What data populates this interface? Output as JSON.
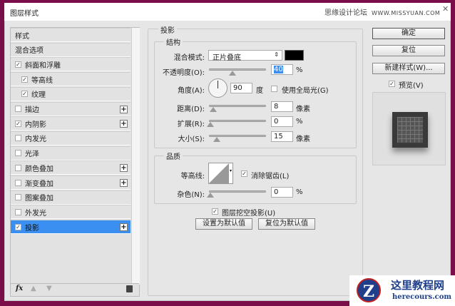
{
  "window": {
    "title": "图层样式",
    "watermark": "思缘设计论坛",
    "watermark_url": "WWW.MISSYUAN.COM"
  },
  "styles_list": {
    "items": [
      {
        "label": "样式",
        "checkbox": false,
        "checked": false,
        "plus": false,
        "indent": 0
      },
      {
        "label": "混合选项",
        "checkbox": false,
        "checked": false,
        "plus": false,
        "indent": 0
      },
      {
        "label": "斜面和浮雕",
        "checkbox": true,
        "checked": true,
        "plus": false,
        "indent": 0
      },
      {
        "label": "等高线",
        "checkbox": true,
        "checked": true,
        "plus": false,
        "indent": 1
      },
      {
        "label": "纹理",
        "checkbox": true,
        "checked": true,
        "plus": false,
        "indent": 1
      },
      {
        "label": "描边",
        "checkbox": true,
        "checked": false,
        "plus": true,
        "indent": 0
      },
      {
        "label": "内阴影",
        "checkbox": true,
        "checked": true,
        "plus": true,
        "indent": 0
      },
      {
        "label": "内发光",
        "checkbox": true,
        "checked": false,
        "plus": false,
        "indent": 0
      },
      {
        "label": "光泽",
        "checkbox": true,
        "checked": false,
        "plus": false,
        "indent": 0
      },
      {
        "label": "颜色叠加",
        "checkbox": true,
        "checked": false,
        "plus": true,
        "indent": 0
      },
      {
        "label": "渐变叠加",
        "checkbox": true,
        "checked": false,
        "plus": true,
        "indent": 0
      },
      {
        "label": "图案叠加",
        "checkbox": true,
        "checked": false,
        "plus": false,
        "indent": 0
      },
      {
        "label": "外发光",
        "checkbox": true,
        "checked": false,
        "plus": false,
        "indent": 0
      },
      {
        "label": "投影",
        "checkbox": true,
        "checked": true,
        "plus": true,
        "indent": 0,
        "selected": true
      }
    ],
    "fx_label": "fx"
  },
  "panel": {
    "title": "投影",
    "structure": {
      "title": "结构",
      "blend_label": "混合模式:",
      "blend_value": "正片叠底",
      "shadow_color": "#000000",
      "opacity_label": "不透明度(O):",
      "opacity": "40",
      "opacity_unit": "%",
      "angle_label": "角度(A):",
      "angle": "90",
      "angle_unit": "度",
      "global_light_label": "使用全局光(G)",
      "distance_label": "距离(D):",
      "distance": "8",
      "distance_unit": "像素",
      "spread_label": "扩展(R):",
      "spread": "0",
      "spread_unit": "%",
      "size_label": "大小(S):",
      "size": "15",
      "size_unit": "像素"
    },
    "quality": {
      "title": "品质",
      "contour_label": "等高线:",
      "antialias_label": "消除锯齿(L)",
      "noise_label": "杂色(N):",
      "noise": "0",
      "noise_unit": "%"
    },
    "knockout_label": "图层挖空投影(U)",
    "set_default": "设置为默认值",
    "reset_default": "复位为默认值"
  },
  "buttons": {
    "ok": "确定",
    "reset": "复位",
    "new_style": "新建样式(W)...",
    "preview": "预览(V)"
  },
  "logo": {
    "name": "这里教程网",
    "url": "herecours.com"
  },
  "accent": "#3a8ff0"
}
